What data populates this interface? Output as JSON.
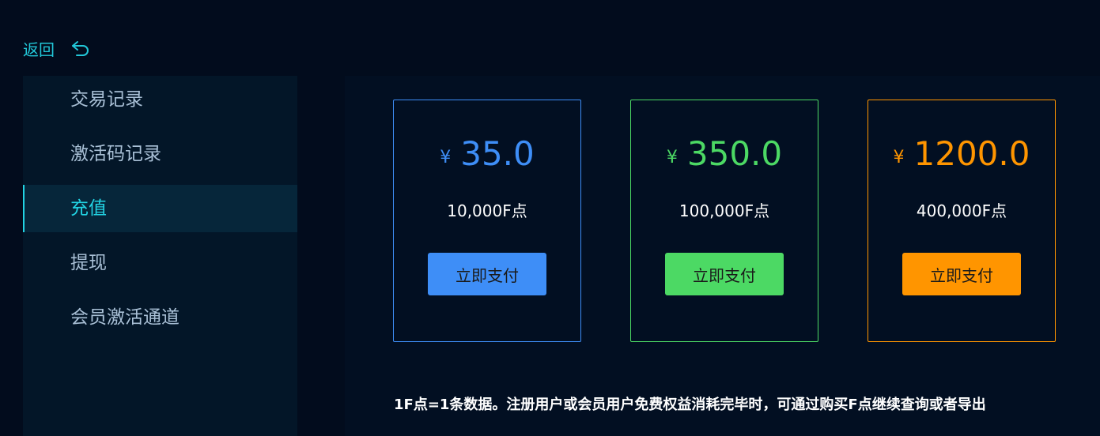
{
  "back": {
    "label": "返回",
    "icon": "return-arrow-icon"
  },
  "sidebar": {
    "items": [
      {
        "label": "交易记录",
        "active": false
      },
      {
        "label": "激活码记录",
        "active": false
      },
      {
        "label": "充值",
        "active": true
      },
      {
        "label": "提现",
        "active": false
      },
      {
        "label": "会员激活通道",
        "active": false
      }
    ]
  },
  "plans": [
    {
      "currency": "¥",
      "amount": "35.0",
      "points": "10,000F点",
      "button": "立即支付",
      "color": "#3e8ef7"
    },
    {
      "currency": "¥",
      "amount": "350.0",
      "points": "100,000F点",
      "button": "立即支付",
      "color": "#4cd964"
    },
    {
      "currency": "¥",
      "amount": "1200.0",
      "points": "400,000F点",
      "button": "立即支付",
      "color": "#ff9500"
    }
  ],
  "note": "1F点=1条数据。注册用户或会员用户免费权益消耗完毕时，可通过购买F点继续查询或者导出"
}
